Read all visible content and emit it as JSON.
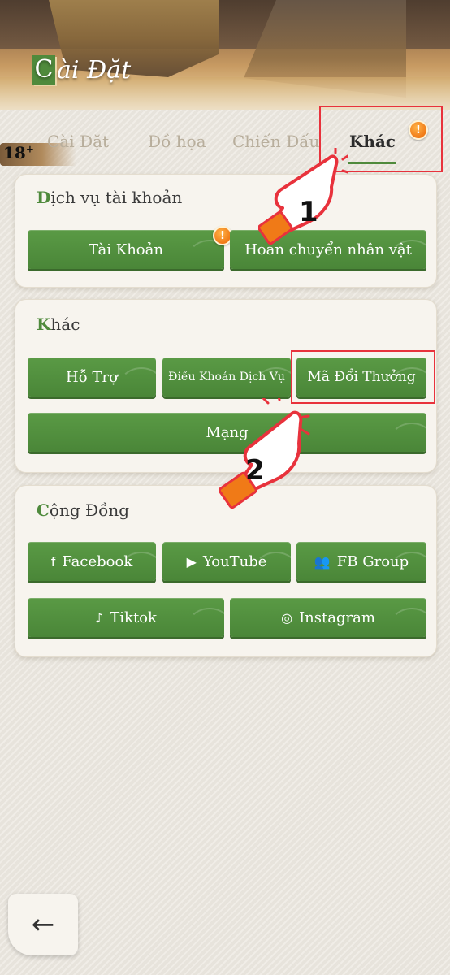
{
  "header": {
    "title_initial": "C",
    "title_rest": "ài Đặt"
  },
  "age_badge": "18",
  "age_badge_plus": "+",
  "tabs": [
    {
      "label": "Cài Đặt"
    },
    {
      "label": "Đồ họa"
    },
    {
      "label": "Chiến Đấu"
    },
    {
      "label": "Khác"
    }
  ],
  "alert_symbol": "!",
  "sections": {
    "account": {
      "title_first": "D",
      "title_rest": "ịch vụ tài khoản",
      "buttons": [
        {
          "label": "Tài Khoản"
        },
        {
          "label": "Hoán chuyển nhân vật"
        }
      ]
    },
    "other": {
      "title_first": "K",
      "title_rest": "hác",
      "buttons": [
        {
          "label": "Hỗ Trợ"
        },
        {
          "label": "Điều Khoản Dịch Vụ"
        },
        {
          "label": "Mã Đổi Thưởng"
        },
        {
          "label": "Mạng"
        }
      ]
    },
    "community": {
      "title_first": "C",
      "title_rest": "ộng Đồng",
      "buttons": [
        {
          "label": "Facebook",
          "icon": "f"
        },
        {
          "label": "YouTube",
          "icon": "▶"
        },
        {
          "label": "FB Group",
          "icon": "👥"
        },
        {
          "label": "Tiktok",
          "icon": "♪"
        },
        {
          "label": "Instagram",
          "icon": "◎"
        }
      ]
    }
  },
  "annotations": {
    "step1": "1",
    "step2": "2"
  },
  "back_icon": "←",
  "colors": {
    "accent_green": "#4f8a3c",
    "highlight_red": "#e8323c",
    "alert_orange": "#f07a17"
  }
}
